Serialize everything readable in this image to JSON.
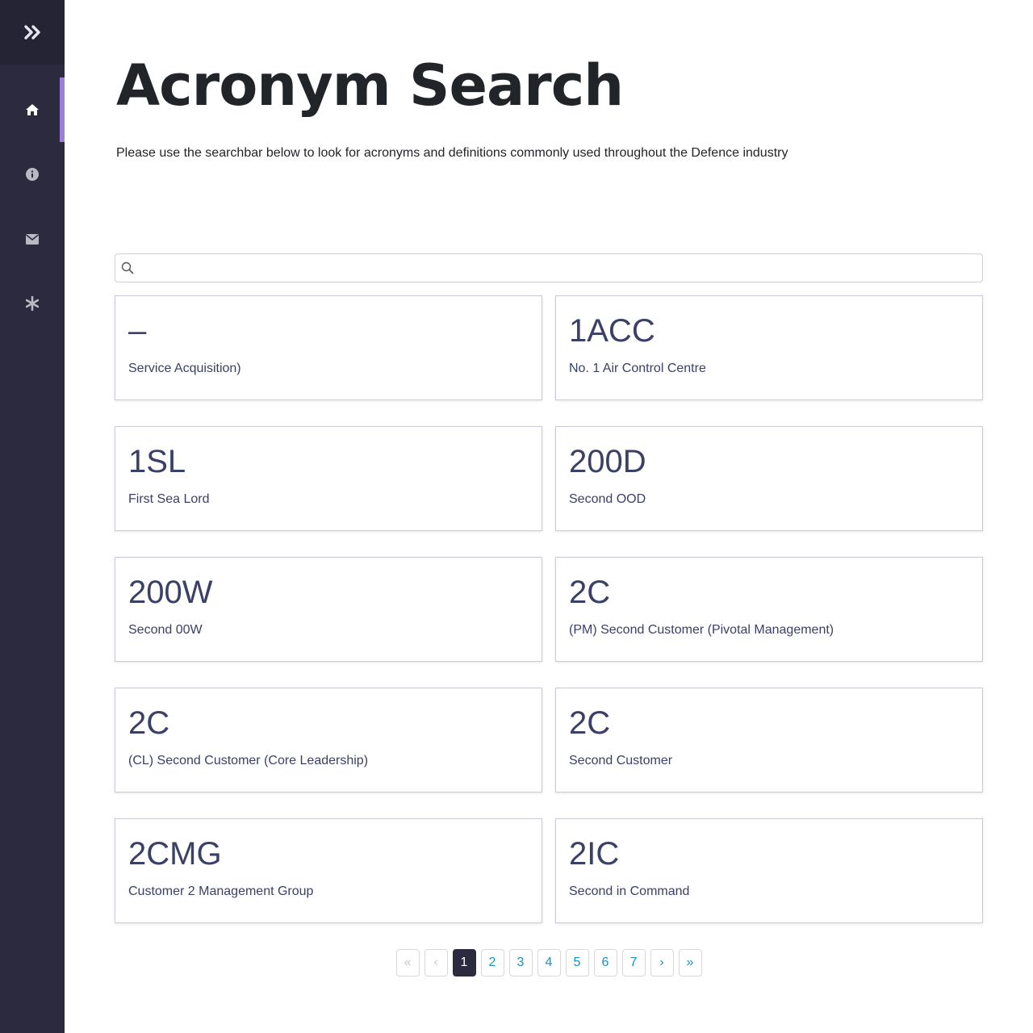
{
  "sidebar": {
    "toggle_icon": "double-chevron-right-icon",
    "items": [
      {
        "name": "home",
        "icon": "home-icon",
        "active": true
      },
      {
        "name": "about",
        "icon": "info-circle-icon",
        "active": false
      },
      {
        "name": "contact",
        "icon": "envelope-icon",
        "active": false
      },
      {
        "name": "other",
        "icon": "asterisk-icon",
        "active": false
      }
    ],
    "accent_color": "#9b7fd4",
    "background_color": "#2b2a3e"
  },
  "page": {
    "title": "Acronym Search",
    "subtitle": "Please use the searchbar below to look for acronyms and definitions commonly used throughout the Defence industry"
  },
  "search": {
    "value": "",
    "placeholder": "",
    "icon": "search-icon"
  },
  "results": [
    {
      "acronym": "–",
      "definition": "Service Acquisition)"
    },
    {
      "acronym": "1ACC",
      "definition": "No. 1 Air Control Centre"
    },
    {
      "acronym": "1SL",
      "definition": "First Sea Lord"
    },
    {
      "acronym": "200D",
      "definition": "Second OOD"
    },
    {
      "acronym": "200W",
      "definition": "Second 00W"
    },
    {
      "acronym": "2C",
      "definition": "(PM) Second Customer (Pivotal Management)"
    },
    {
      "acronym": "2C",
      "definition": "(CL) Second Customer (Core Leadership)"
    },
    {
      "acronym": "2C",
      "definition": "Second Customer"
    },
    {
      "acronym": "2CMG",
      "definition": "Customer 2 Management Group"
    },
    {
      "acronym": "2IC",
      "definition": "Second in Command"
    }
  ],
  "pagination": {
    "first": "«",
    "prev": "‹",
    "pages": [
      "1",
      "2",
      "3",
      "4",
      "5",
      "6",
      "7"
    ],
    "current": "1",
    "next": "›",
    "last": "»"
  }
}
